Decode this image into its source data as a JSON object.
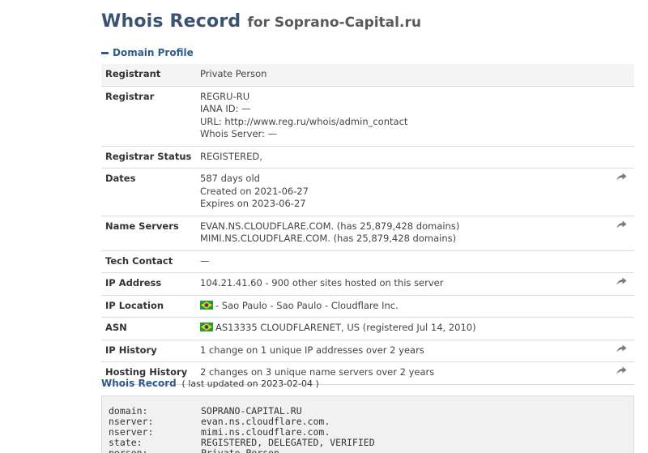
{
  "header": {
    "title": "Whois Record",
    "subtitle": "for Soprano-Capital.ru"
  },
  "section": {
    "label": "Domain Profile"
  },
  "rows": [
    {
      "label": "Registrant",
      "lines": [
        "Private Person"
      ],
      "flag": false,
      "share": false
    },
    {
      "label": "Registrar",
      "lines": [
        "REGRU-RU",
        "IANA ID: —",
        "URL: http://www.reg.ru/whois/admin_contact",
        "Whois Server: —"
      ],
      "flag": false,
      "share": false
    },
    {
      "label": "Registrar Status",
      "lines": [
        "REGISTERED,"
      ],
      "flag": false,
      "share": false
    },
    {
      "label": "Dates",
      "lines": [
        "587 days old",
        "Created on 2021-06-27",
        "Expires on 2023-06-27"
      ],
      "flag": false,
      "share": true
    },
    {
      "label": "Name Servers",
      "lines": [
        "EVAN.NS.CLOUDFLARE.COM. (has 25,879,428 domains)",
        "MIMI.NS.CLOUDFLARE.COM. (has 25,879,428 domains)"
      ],
      "flag": false,
      "share": true
    },
    {
      "label": "Tech Contact",
      "lines": [
        "—"
      ],
      "flag": false,
      "share": false
    },
    {
      "label": "IP Address",
      "lines": [
        "104.21.41.60 - 900 other sites hosted on this server"
      ],
      "flag": false,
      "share": true
    },
    {
      "label": "IP Location",
      "lines": [
        "- Sao Paulo - Sao Paulo - Cloudflare Inc."
      ],
      "flag": true,
      "share": false
    },
    {
      "label": "ASN",
      "lines": [
        "AS13335 CLOUDFLARENET, US (registered Jul 14, 2010)"
      ],
      "flag": true,
      "share": false
    },
    {
      "label": "IP History",
      "lines": [
        "1 change on 1 unique IP addresses over 2 years"
      ],
      "flag": false,
      "share": true
    },
    {
      "label": "Hosting History",
      "lines": [
        "2 changes on 3 unique name servers over 2 years"
      ],
      "flag": false,
      "share": true
    }
  ],
  "record": {
    "label": "Whois Record",
    "updated": "( last updated on 2023-02-04 )"
  },
  "raw_lines": [
    {
      "k": "domain:",
      "v": "SOPRANO-CAPITAL.RU"
    },
    {
      "k": "nserver:",
      "v": "evan.ns.cloudflare.com."
    },
    {
      "k": "nserver:",
      "v": "mimi.ns.cloudflare.com."
    },
    {
      "k": "state:",
      "v": "REGISTERED, DELEGATED, VERIFIED"
    },
    {
      "k": "person:",
      "v": "Private Person"
    }
  ],
  "icons": {
    "share": "share-arrow-icon",
    "flag": "brazil-flag-icon"
  },
  "colors": {
    "title": "#3a5373",
    "link": "#2f5b8a",
    "flag_green": "#1f9d3a",
    "flag_yellow": "#f5d000",
    "flag_blue": "#24408e"
  }
}
